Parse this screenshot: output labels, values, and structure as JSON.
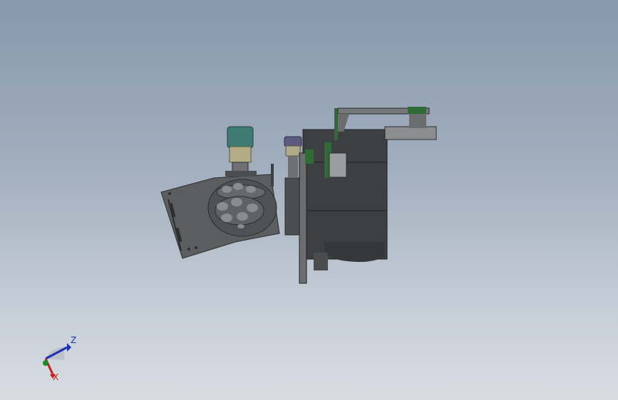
{
  "view": {
    "background_top": "#8898ad",
    "background_bottom": "#d8dde3"
  },
  "model": {
    "colors": {
      "metal": "#5b5d5e",
      "metal_dark": "#3d3f40",
      "motor_teal": "#3e7b72",
      "motor_purple": "#5e5a7f",
      "pcb_green": "#2e6b36"
    }
  },
  "triad": {
    "z_label": "Z",
    "x_label": "X",
    "z_color": "#1a2fb3",
    "x_color": "#c81e1e",
    "y_color": "#1f8a2a"
  }
}
